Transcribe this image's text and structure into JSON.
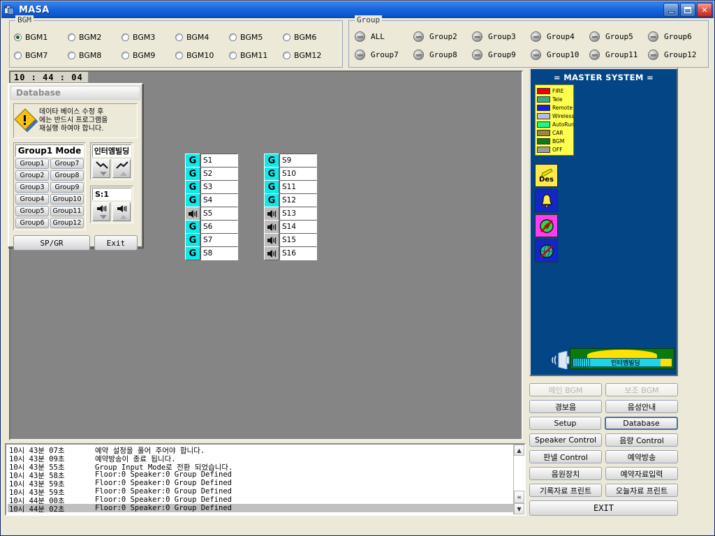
{
  "window": {
    "title": "MASA",
    "icon": "app-icon",
    "buttons": {
      "minimize": "minimize",
      "maximize": "maximize",
      "close": "close"
    }
  },
  "bgm": {
    "legend": "BGM",
    "selected": "BGM1",
    "rows": [
      [
        "BGM1",
        "BGM2",
        "BGM3",
        "BGM4",
        "BGM5",
        "BGM6"
      ],
      [
        "BGM7",
        "BGM8",
        "BGM9",
        "BGM10",
        "BGM11",
        "BGM12"
      ]
    ]
  },
  "group": {
    "legend": "Group",
    "rows": [
      [
        "ALL",
        "Group2",
        "Group3",
        "Group4",
        "Group5",
        "Group6"
      ],
      [
        "Group7",
        "Group8",
        "Group9",
        "Group10",
        "Group11",
        "Group12"
      ]
    ]
  },
  "clock": "10 : 44 : 04",
  "database_window": {
    "title": "Database",
    "warning": "데이타 베이스 수정 후\n에는 반드시 프로그램을\n재실행 하여야 합니다.",
    "mode_title": "Group1 Mode",
    "mode_buttons": [
      "Group1",
      "Group7",
      "Group2",
      "Group8",
      "Group3",
      "Group9",
      "Group4",
      "Group10",
      "Group5",
      "Group11",
      "Group6",
      "Group12"
    ],
    "interm_title": "인터엠빌딩",
    "speaker_title": "S:1",
    "sp_gr_button": "SP/GR",
    "exit_button": "Exit"
  },
  "speakers": {
    "column1": [
      {
        "name": "S1",
        "icon": "G"
      },
      {
        "name": "S2",
        "icon": "G"
      },
      {
        "name": "S3",
        "icon": "G"
      },
      {
        "name": "S4",
        "icon": "G"
      },
      {
        "name": "S5",
        "icon": "speaker"
      },
      {
        "name": "S6",
        "icon": "G"
      },
      {
        "name": "S7",
        "icon": "G"
      },
      {
        "name": "S8",
        "icon": "G"
      }
    ],
    "column2": [
      {
        "name": "S9",
        "icon": "G"
      },
      {
        "name": "S10",
        "icon": "G"
      },
      {
        "name": "S11",
        "icon": "G"
      },
      {
        "name": "S12",
        "icon": "G"
      },
      {
        "name": "S13",
        "icon": "speaker"
      },
      {
        "name": "S14",
        "icon": "speaker"
      },
      {
        "name": "S15",
        "icon": "speaker"
      },
      {
        "name": "S16",
        "icon": "speaker"
      }
    ]
  },
  "master_system": {
    "title": "= MASTER SYSTEM =",
    "legend": [
      {
        "label": "FIRE",
        "color": "#ee0000"
      },
      {
        "label": "Tele",
        "color": "#3aa88d"
      },
      {
        "label": "Remote",
        "color": "#1a1ae8"
      },
      {
        "label": "Wireless",
        "color": "#b9b9ef"
      },
      {
        "label": "AutoRun",
        "color": "#20f58c"
      },
      {
        "label": "CAR",
        "color": "#9a8833"
      },
      {
        "label": "BGM",
        "color": "#0a7a1a"
      },
      {
        "label": "OFF",
        "color": "#9b9b9b"
      }
    ],
    "icon_buttons": [
      {
        "name": "des-button",
        "label": "Des"
      },
      {
        "name": "bell-button",
        "label": ""
      },
      {
        "name": "mic-mute-button",
        "label": ""
      },
      {
        "name": "globe-mute-button",
        "label": ""
      }
    ],
    "bottom_graphic_text": "인터엠빌딩"
  },
  "right_buttons": {
    "rows": [
      [
        {
          "label": "메인 BGM",
          "state": "disabled"
        },
        {
          "label": "보조 BGM",
          "state": "disabled"
        }
      ],
      [
        {
          "label": "경보음",
          "state": "normal"
        },
        {
          "label": "음성안내",
          "state": "normal"
        }
      ],
      [
        {
          "label": "Setup",
          "state": "normal"
        },
        {
          "label": "Database",
          "state": "focus"
        }
      ],
      [
        {
          "label": "Speaker Control",
          "state": "normal"
        },
        {
          "label": "음량 Control",
          "state": "normal"
        }
      ],
      [
        {
          "label": "판넬 Control",
          "state": "normal"
        },
        {
          "label": "예약방송",
          "state": "normal"
        }
      ],
      [
        {
          "label": "음원장치",
          "state": "normal"
        },
        {
          "label": "예약자료입력",
          "state": "normal"
        }
      ],
      [
        {
          "label": "기록자료 프린트",
          "state": "normal"
        },
        {
          "label": "오늘자료 프린트",
          "state": "normal"
        }
      ]
    ],
    "exit": "EXIT"
  },
  "log": {
    "entries": [
      {
        "time": "10시 43분 07초",
        "message": "예약 설정을 풀어 주어야 합니다.",
        "selected": false
      },
      {
        "time": "10시 43분 09초",
        "message": "예약방송이 종료 됩니다.",
        "selected": false
      },
      {
        "time": "10시 43분 55초",
        "message": "Group Input Mode로 전환 되었습니다.",
        "selected": false
      },
      {
        "time": "10시 43분 58초",
        "message": "Floor:0 Speaker:0  Group Defined",
        "selected": false
      },
      {
        "time": "10시 43분 59초",
        "message": "Floor:0 Speaker:0  Group Defined",
        "selected": false
      },
      {
        "time": "10시 43분 59초",
        "message": "Floor:0 Speaker:0  Group Defined",
        "selected": false
      },
      {
        "time": "10시 44분 00초",
        "message": "Floor:0 Speaker:0  Group Defined",
        "selected": false
      },
      {
        "time": "10시 44분 02초",
        "message": "Floor:0 Speaker:0  Group Defined",
        "selected": true
      }
    ],
    "scroll_up": "▲",
    "scroll_down": "▼"
  },
  "colors": {
    "titlebar": "#1a6ae0",
    "canvas": "#858585",
    "master_bg": "#044585",
    "group_icon": "#12e8e8",
    "face": "#ece9d8"
  }
}
